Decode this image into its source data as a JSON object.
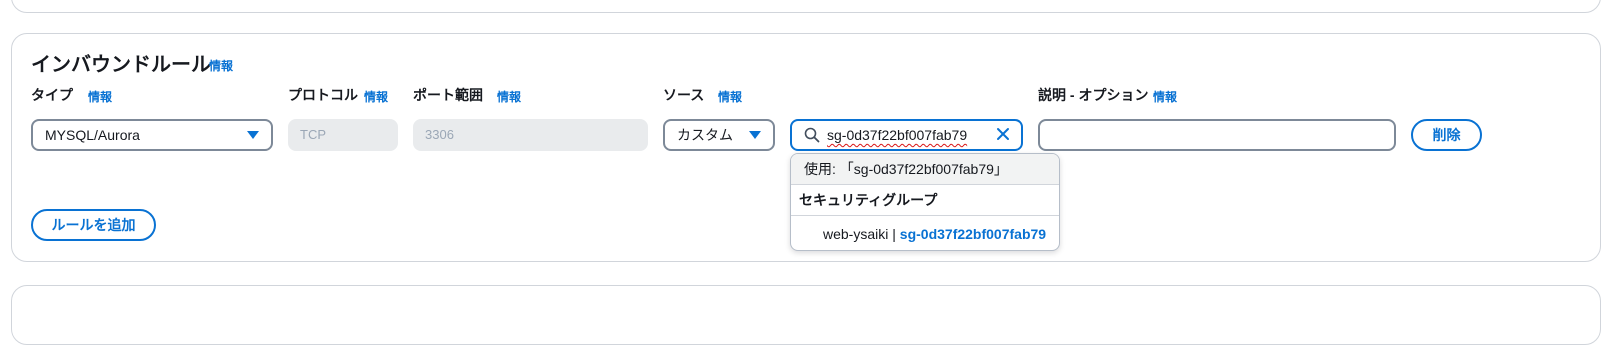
{
  "section": {
    "title": "インバウンドルール",
    "info_label": "情報"
  },
  "columns": {
    "type": {
      "label": "タイプ",
      "info": "情報"
    },
    "protocol": {
      "label": "プロトコル",
      "info": "情報"
    },
    "port_range": {
      "label": "ポート範囲",
      "info": "情報"
    },
    "source": {
      "label": "ソース",
      "info": "情報"
    },
    "description": {
      "label": "説明 - オプション",
      "info": "情報"
    }
  },
  "rule": {
    "type_value": "MYSQL/Aurora",
    "protocol_value": "TCP",
    "port_value": "3306",
    "source_value": "カスタム",
    "search_value": "sg-0d37f22bf007fab79",
    "description_value": "",
    "delete_label": "削除"
  },
  "dropdown": {
    "use_option": "使用: 「sg-0d37f22bf007fab79」",
    "group_header": "セキュリティグループ",
    "items": [
      {
        "name": "web-ysaiki",
        "separator": " | ",
        "id": "sg-0d37f22bf007fab79"
      }
    ]
  },
  "actions": {
    "add_rule_label": "ルールを追加"
  },
  "colors": {
    "accent": "#0972d3",
    "error_underline": "#d91515",
    "disabled_bg": "#e9ebed"
  }
}
